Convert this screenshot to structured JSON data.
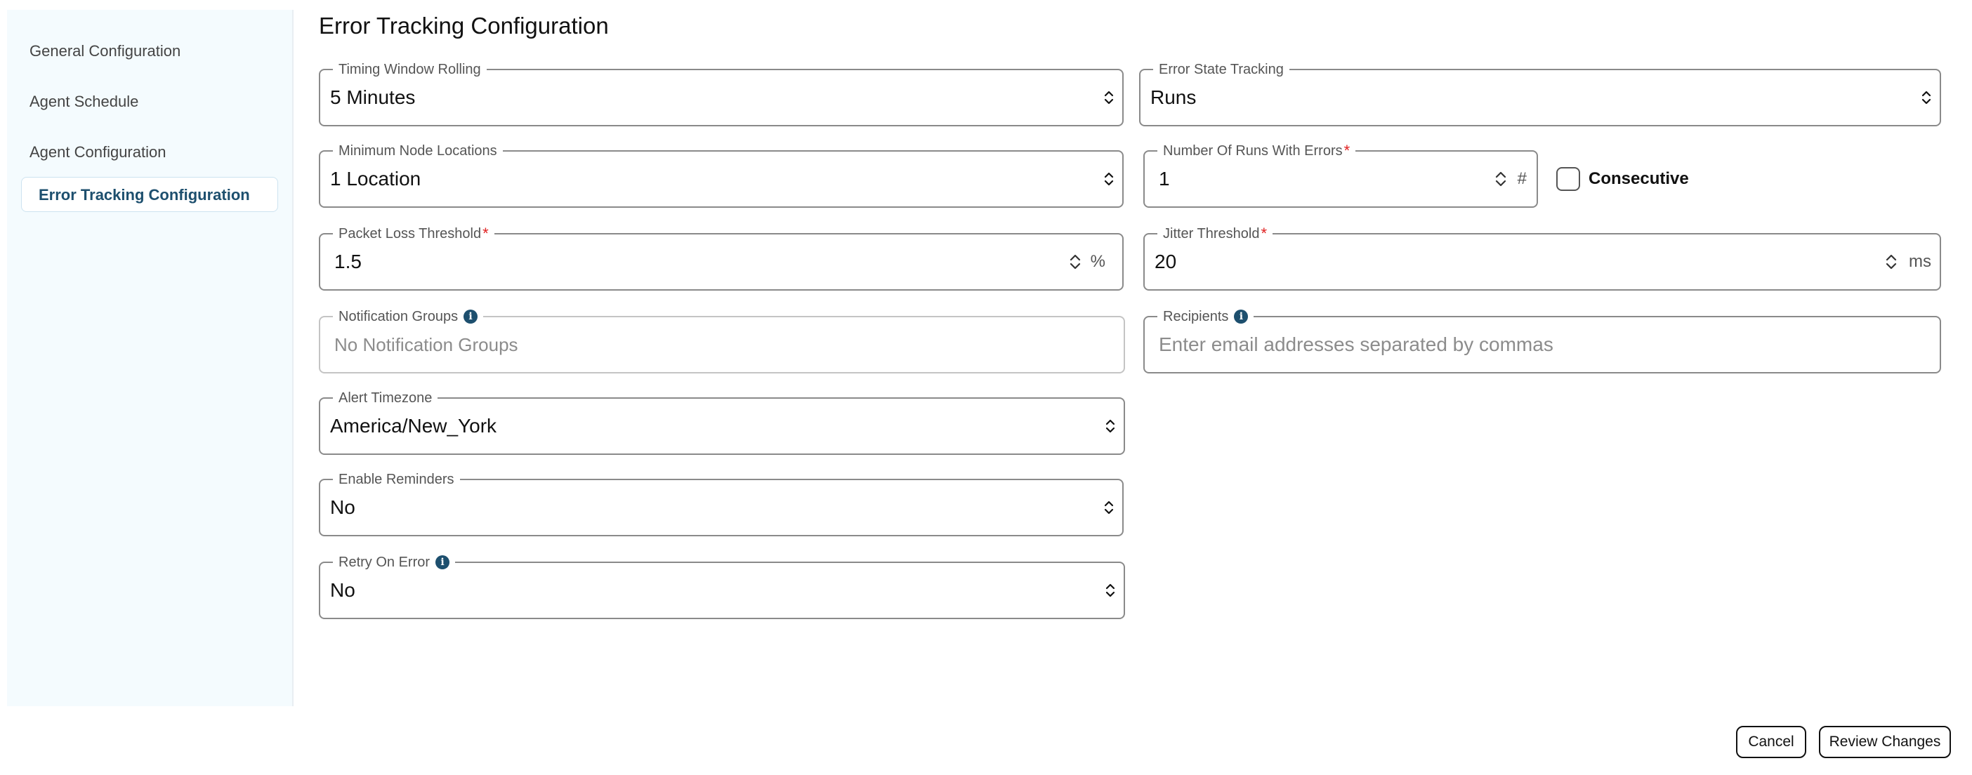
{
  "sidebar": {
    "items": [
      {
        "label": "General Configuration"
      },
      {
        "label": "Agent Schedule"
      },
      {
        "label": "Agent Configuration"
      },
      {
        "label": "Error Tracking Configuration",
        "active": true
      }
    ]
  },
  "page": {
    "title": "Error Tracking Configuration"
  },
  "form": {
    "timing_window": {
      "label": "Timing Window Rolling",
      "value": "5 Minutes"
    },
    "error_state": {
      "label": "Error State Tracking",
      "value": "Runs"
    },
    "min_node_locations": {
      "label": "Minimum Node Locations",
      "value": "1 Location"
    },
    "runs_with_errors": {
      "label": "Number Of Runs With Errors",
      "required_mark": "*",
      "value": "1",
      "unit": "#"
    },
    "consecutive": {
      "label": "Consecutive",
      "checked": false
    },
    "packet_loss": {
      "label": "Packet Loss Threshold",
      "required_mark": "*",
      "value": "1.5",
      "unit": "%"
    },
    "jitter": {
      "label": "Jitter Threshold",
      "required_mark": "*",
      "value": "20",
      "unit": "ms"
    },
    "notification_groups": {
      "label": "Notification Groups",
      "placeholder": "No Notification Groups"
    },
    "recipients": {
      "label": "Recipients",
      "placeholder": "Enter email addresses separated by commas"
    },
    "alert_timezone": {
      "label": "Alert Timezone",
      "value": "America/New_York"
    },
    "enable_reminders": {
      "label": "Enable Reminders",
      "value": "No"
    },
    "retry_on_error": {
      "label": "Retry On Error",
      "value": "No"
    }
  },
  "footer": {
    "cancel_label": "Cancel",
    "review_label": "Review Changes"
  },
  "colors": {
    "accent": "#1d4f6e",
    "required": "#e02020",
    "sidebar_bg": "#f4fbfe"
  },
  "icons": {
    "info": "info-icon",
    "select": "chevron-updown-icon",
    "spinner": "spinner-icon"
  }
}
